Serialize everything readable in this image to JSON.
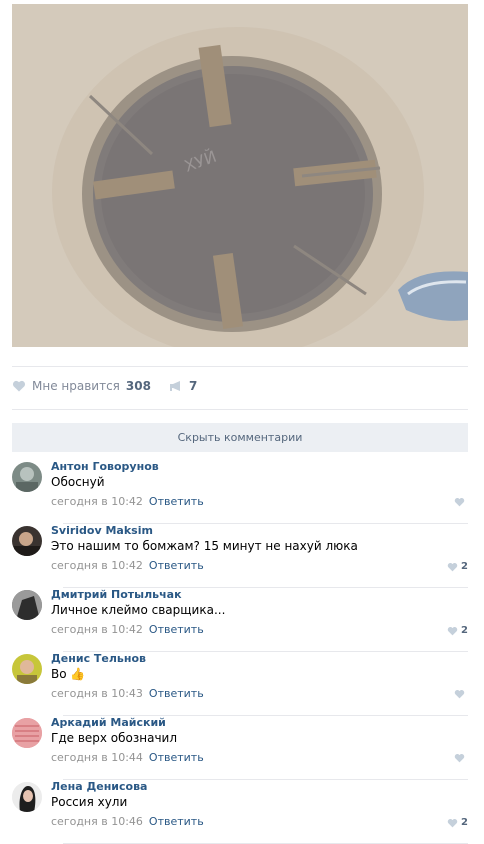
{
  "post": {
    "image_text": "ХУЙ",
    "likes_label": "Мне нравится",
    "likes_count": "308",
    "shares_count": "7"
  },
  "hide_comments_label": "Скрыть комментарии",
  "reply_label": "Ответить",
  "comments": [
    {
      "author": "Антон Говорунов",
      "text": "Обоснуй",
      "time": "сегодня в 10:42",
      "likes": ""
    },
    {
      "author": "Sviridov Maksim",
      "text": "Это нашим то бомжам? 15 минут не нахуй люка",
      "time": "сегодня в 10:42",
      "likes": "2"
    },
    {
      "author": "Дмитрий Потыльчак",
      "text": "Личное клеймо сварщика...",
      "time": "сегодня в 10:42",
      "likes": "2"
    },
    {
      "author": "Денис Тельнов",
      "text": "Во",
      "emoji": "👍",
      "time": "сегодня в 10:43",
      "likes": ""
    },
    {
      "author": "Аркадий Майский",
      "text": "Где верх обозначил",
      "time": "сегодня в 10:44",
      "likes": ""
    },
    {
      "author": "Лена Денисова",
      "text": "Россия хули",
      "time": "сегодня в 10:46",
      "likes": "2"
    }
  ],
  "colors": {
    "link": "#2a5885",
    "meta": "#939393",
    "muted": "#828a99",
    "hide_bar_bg": "#eceff3",
    "heart": "#c5d0db"
  }
}
